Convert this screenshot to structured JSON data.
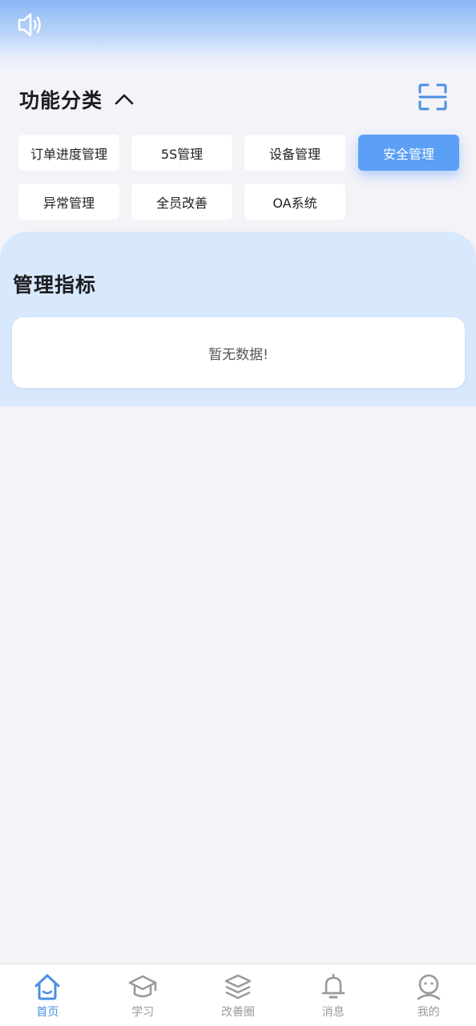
{
  "header": {
    "speaker_icon": "speaker-icon",
    "scan_icon": "scan-icon"
  },
  "functions": {
    "title": "功能分类",
    "toggle_icon": "chevron-up-icon",
    "items": [
      {
        "label": "订单进度管理",
        "active": false
      },
      {
        "label": "5S管理",
        "active": false
      },
      {
        "label": "设备管理",
        "active": false
      },
      {
        "label": "安全管理",
        "active": true
      },
      {
        "label": "异常管理",
        "active": false
      },
      {
        "label": "全员改善",
        "active": false
      },
      {
        "label": "OA系统",
        "active": false
      }
    ]
  },
  "metrics": {
    "title": "管理指标",
    "empty_text": "暂无数据!"
  },
  "tabbar": {
    "items": [
      {
        "label": "首页",
        "icon": "home-icon",
        "active": true
      },
      {
        "label": "学习",
        "icon": "graduation-cap-icon",
        "active": false
      },
      {
        "label": "改善圈",
        "icon": "layers-icon",
        "active": false
      },
      {
        "label": "消息",
        "icon": "bell-icon",
        "active": false
      },
      {
        "label": "我的",
        "icon": "user-icon",
        "active": false
      }
    ]
  },
  "colors": {
    "accent": "#5b9ff6",
    "tab_active": "#4a90e2",
    "panel_bg": "#d9e9fd",
    "page_bg": "#f3f3f8"
  }
}
